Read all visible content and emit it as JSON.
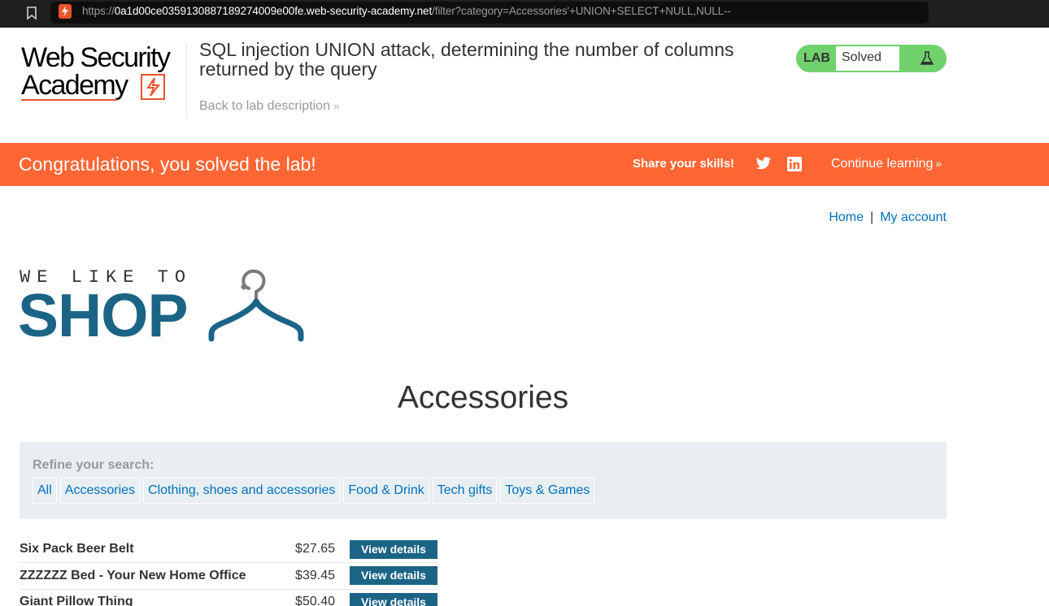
{
  "browser": {
    "url_scheme": "https://",
    "url_host": "0a1d00ce0359130887189274009e00fe.web-security-academy.net",
    "url_path": "/filter?category=Accessories'+UNION+SELECT+NULL,NULL--"
  },
  "academy": {
    "logo_line1": "Web Security",
    "logo_line2": "Academy",
    "lab_title": "SQL injection UNION attack, determining the number of columns returned by the query",
    "back_link": "Back to lab description",
    "lab_label": "LAB",
    "lab_status": "Solved",
    "status_color": "#70d16d"
  },
  "banner": {
    "message": "Congratulations, you solved the lab!",
    "share": "Share your skills!",
    "continue": "Continue learning",
    "color": "#ff6633"
  },
  "nav": {
    "home": "Home",
    "separator": "|",
    "account": "My account"
  },
  "shop_logo": {
    "tagline": "WE LIKE TO",
    "word": "SHOP"
  },
  "page": {
    "heading": "Accessories"
  },
  "filters": {
    "title": "Refine your search:",
    "items": [
      {
        "label": "All"
      },
      {
        "label": "Accessories"
      },
      {
        "label": "Clothing, shoes and accessories"
      },
      {
        "label": "Food & Drink"
      },
      {
        "label": "Tech gifts"
      },
      {
        "label": "Toys & Games"
      }
    ]
  },
  "products": {
    "button_label": "View details",
    "rows": [
      {
        "name": "Six Pack Beer Belt",
        "price": "$27.65"
      },
      {
        "name": "ZZZZZZ Bed - Your New Home Office",
        "price": "$39.45"
      },
      {
        "name": "Giant Pillow Thing",
        "price": "$50.40"
      }
    ]
  }
}
